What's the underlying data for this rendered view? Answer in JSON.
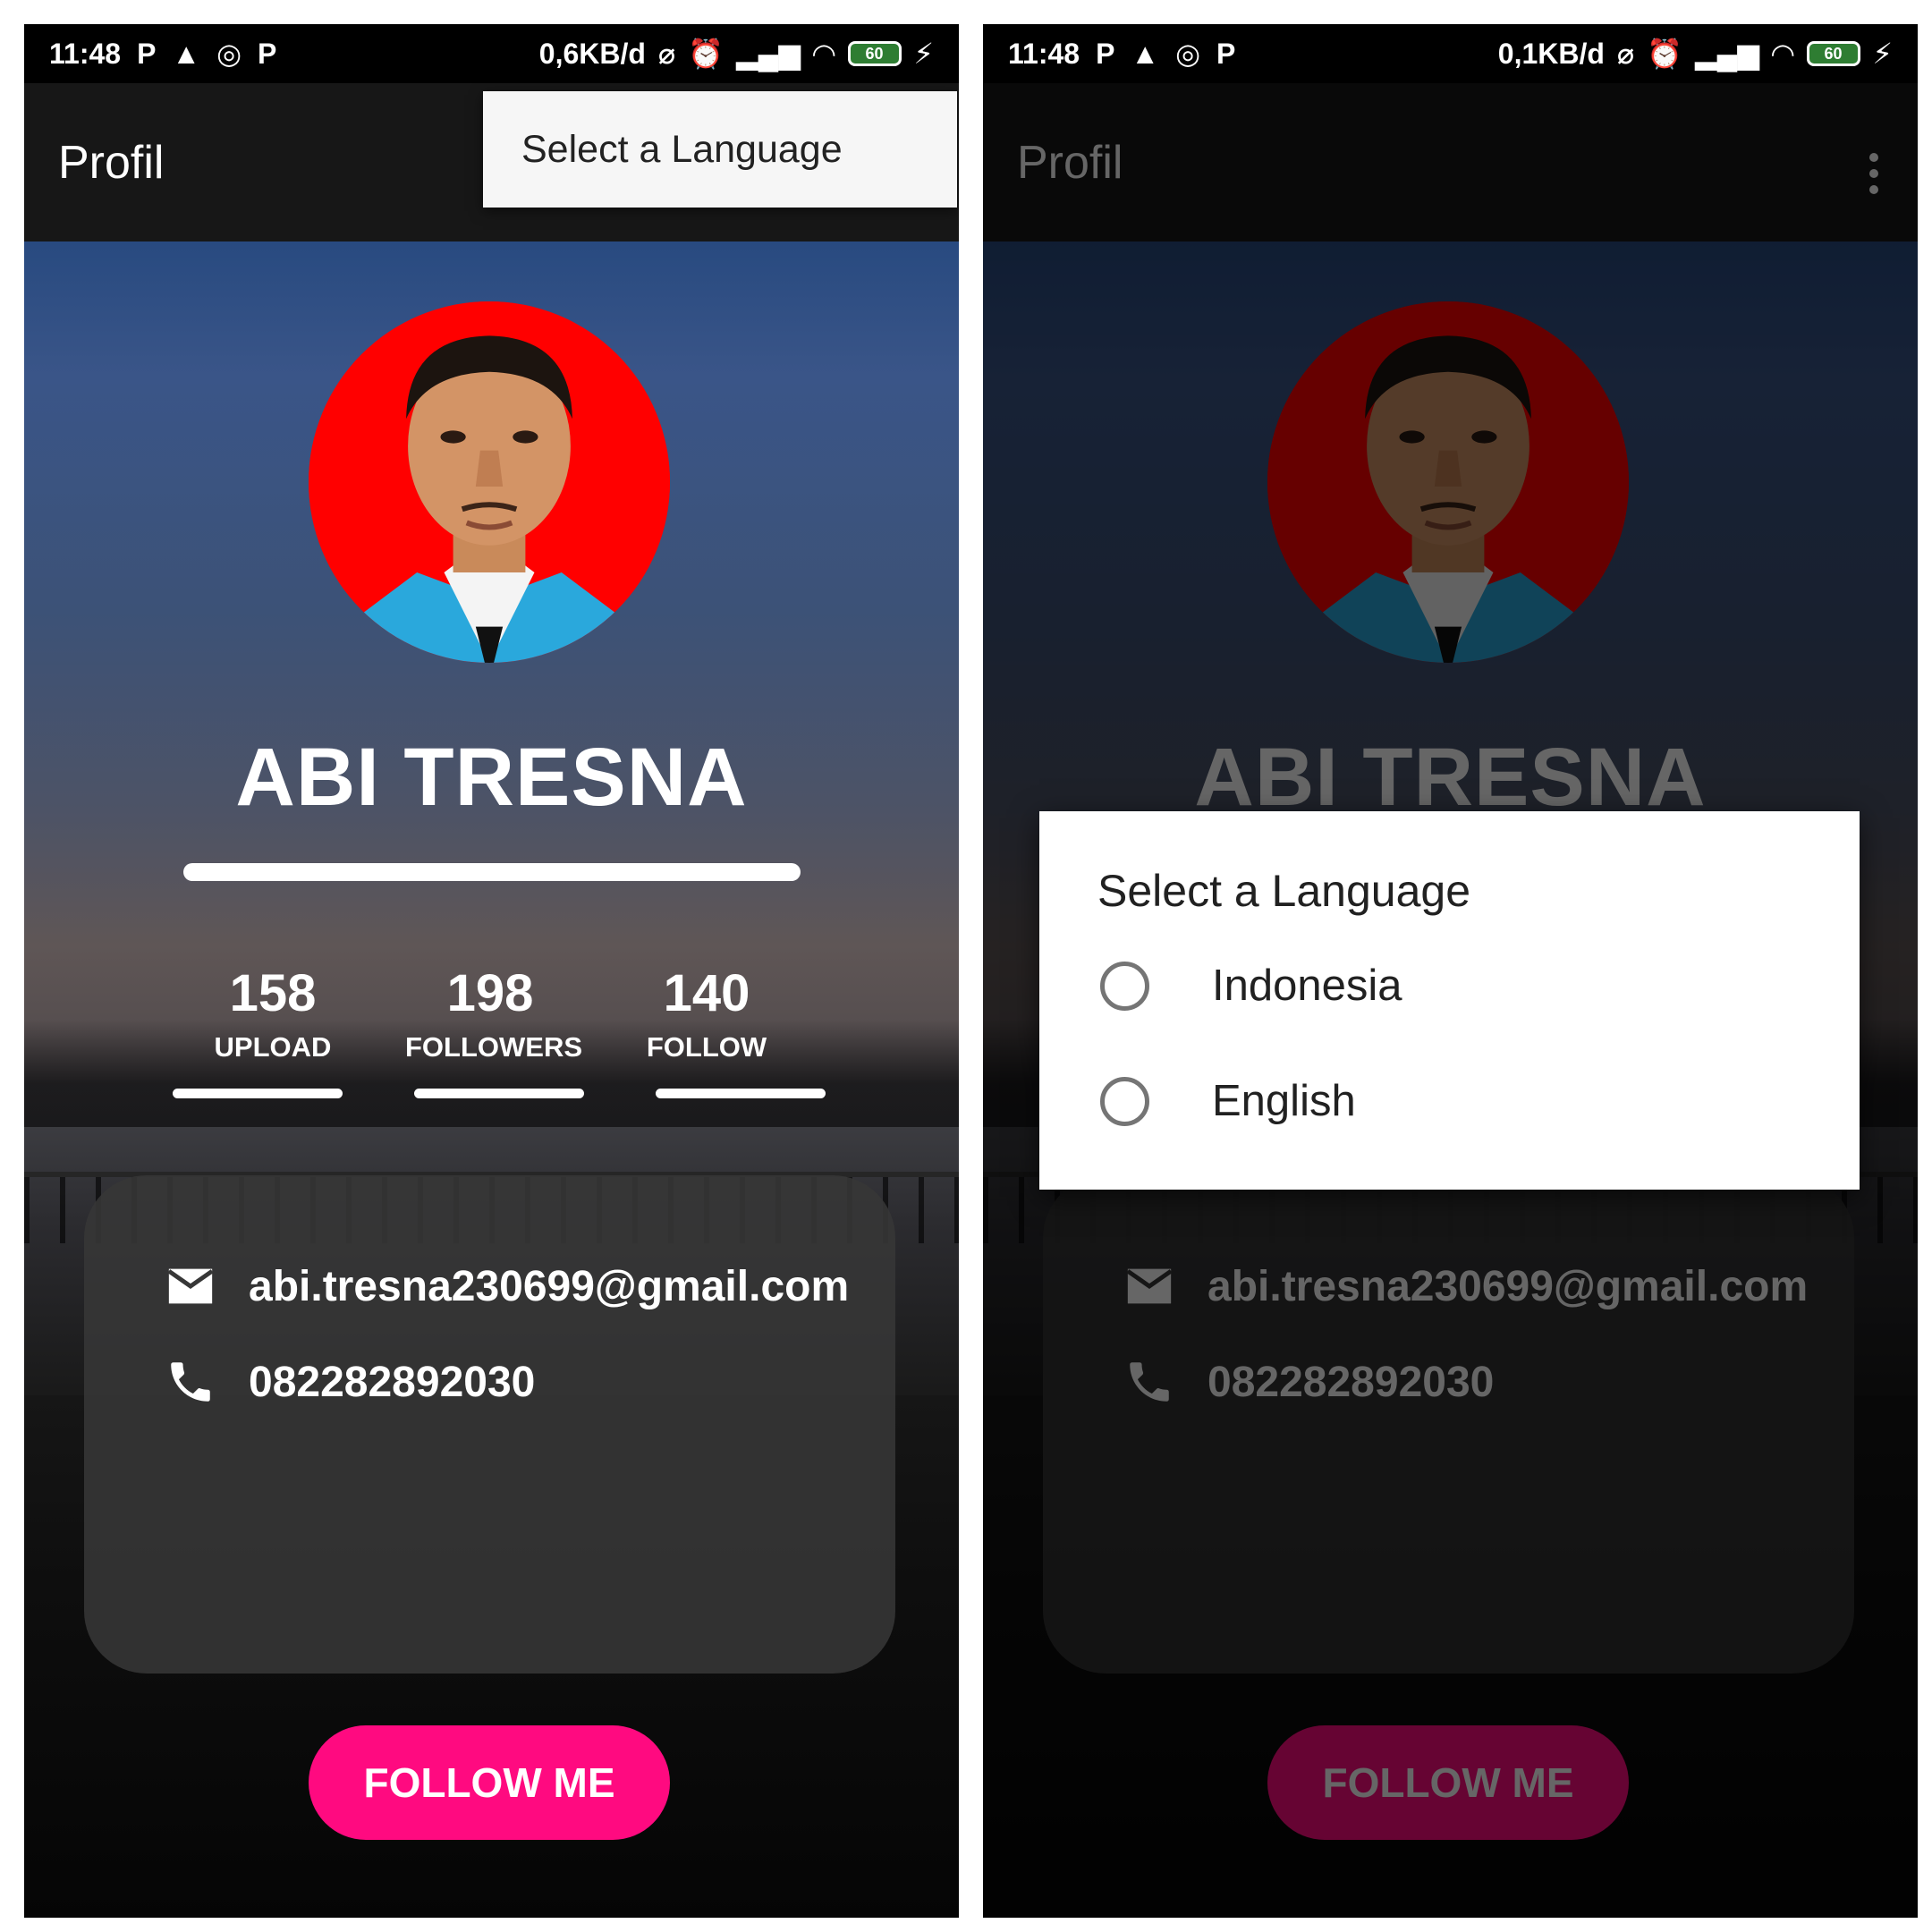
{
  "status_bar": [
    {
      "time": "11:48",
      "data_rate": "0,6KB/d",
      "battery": "60"
    },
    {
      "time": "11:48",
      "data_rate": "0,1KB/d",
      "battery": "60"
    }
  ],
  "toolbar": {
    "title": "Profil"
  },
  "popup_menu": {
    "item": "Select a Language"
  },
  "profile": {
    "name": "ABI TRESNA",
    "stats": [
      {
        "value": "158",
        "label": "UPLOAD"
      },
      {
        "value": "198",
        "label": "FOLLOWERS"
      },
      {
        "value": "140",
        "label": "FOLLOW"
      }
    ],
    "email": "abi.tresna230699@gmail.com",
    "phone": "082282892030",
    "follow_button": "FOLLOW ME"
  },
  "dialog": {
    "title": "Select a Language",
    "options": [
      "Indonesia",
      "English"
    ]
  },
  "colors": {
    "accent": "#ff0a80",
    "avatar_background": "#ff0000",
    "toolbar": "#171717"
  },
  "icons": [
    "email-icon",
    "phone-icon",
    "overflow-menu-icon",
    "wifi-icon",
    "signal-icon",
    "alarm-icon",
    "battery-icon"
  ]
}
